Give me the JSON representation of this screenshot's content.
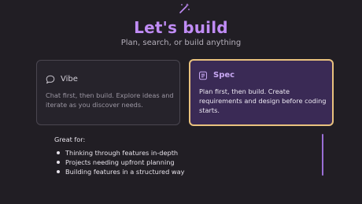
{
  "header": {
    "icon": "magic-wand-icon",
    "title": "Let's build",
    "subtitle": "Plan, search, or build anything"
  },
  "modes": [
    {
      "id": "vibe",
      "icon": "chat-bubble-icon",
      "label": "Vibe",
      "description": "Chat first, then build. Explore ideas and iterate as you discover needs.",
      "selected": false
    },
    {
      "id": "spec",
      "icon": "document-list-icon",
      "label": "Spec",
      "description": "Plan first, then build. Create requirements and design before coding starts.",
      "selected": true
    }
  ],
  "details": {
    "heading": "Great for:",
    "items": [
      "Thinking through features in-depth",
      "Projects needing upfront planning",
      "Building features in a structured way"
    ]
  },
  "colors": {
    "background": "#211e24",
    "title": "#c08cf5",
    "selected_border": "#e9c27e",
    "selected_fill": "#3a2a55",
    "accent_bar": "#9a6fd6"
  }
}
